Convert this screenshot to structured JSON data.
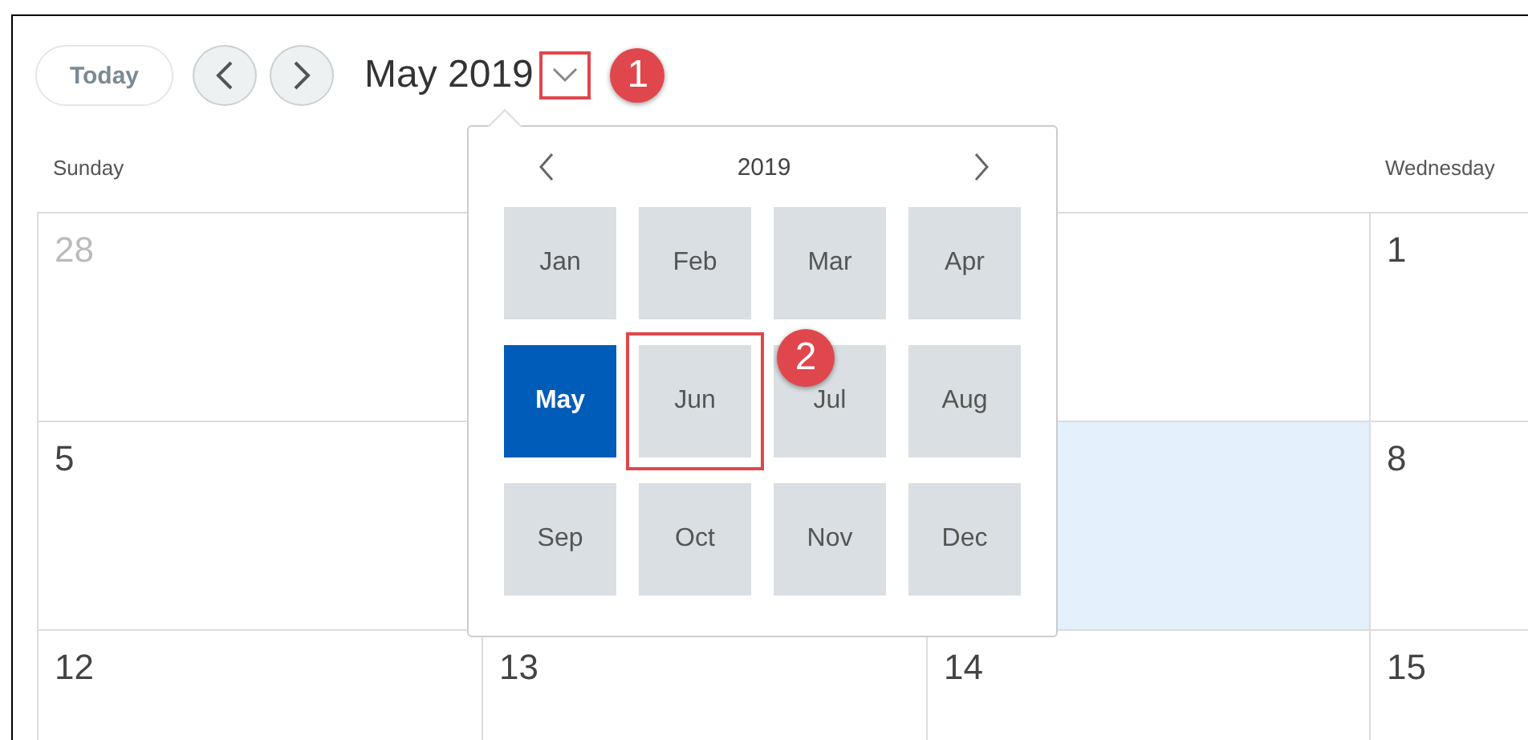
{
  "toolbar": {
    "today_button": "Today",
    "title": "May 2019",
    "dropdown_callout": "1"
  },
  "day_headers": [
    {
      "kind": "shown",
      "label": "Sunday"
    },
    {
      "kind": "covered"
    },
    {
      "kind": "covered"
    },
    {
      "kind": "shown",
      "label": "Wednesday"
    }
  ],
  "weeks": [
    {
      "days": [
        {
          "kind": "shown",
          "day": "28",
          "other_month": true
        },
        {
          "kind": "covered"
        },
        {
          "kind": "covered"
        },
        {
          "kind": "shown",
          "day": "1",
          "other_month": false
        }
      ]
    },
    {
      "days": [
        {
          "kind": "shown",
          "day": "5"
        },
        {
          "kind": "covered"
        },
        {
          "kind": "covered",
          "today": true
        },
        {
          "kind": "shown",
          "day": "8"
        }
      ]
    },
    {
      "days": [
        {
          "kind": "shown",
          "day": "12"
        },
        {
          "kind": "shown",
          "day": "13"
        },
        {
          "kind": "shown",
          "day": "14"
        },
        {
          "kind": "shown",
          "day": "15"
        }
      ]
    }
  ],
  "month_picker": {
    "year": "2019",
    "months": [
      {
        "label": "Jan",
        "selected": false
      },
      {
        "label": "Feb",
        "selected": false
      },
      {
        "label": "Mar",
        "selected": false
      },
      {
        "label": "Apr",
        "selected": false
      },
      {
        "label": "May",
        "selected": true
      },
      {
        "label": "Jun",
        "selected": false,
        "callout": "2"
      },
      {
        "label": "Jul",
        "selected": false
      },
      {
        "label": "Aug",
        "selected": false
      },
      {
        "label": "Sep",
        "selected": false
      },
      {
        "label": "Oct",
        "selected": false
      },
      {
        "label": "Nov",
        "selected": false
      },
      {
        "label": "Dec",
        "selected": false
      }
    ]
  }
}
